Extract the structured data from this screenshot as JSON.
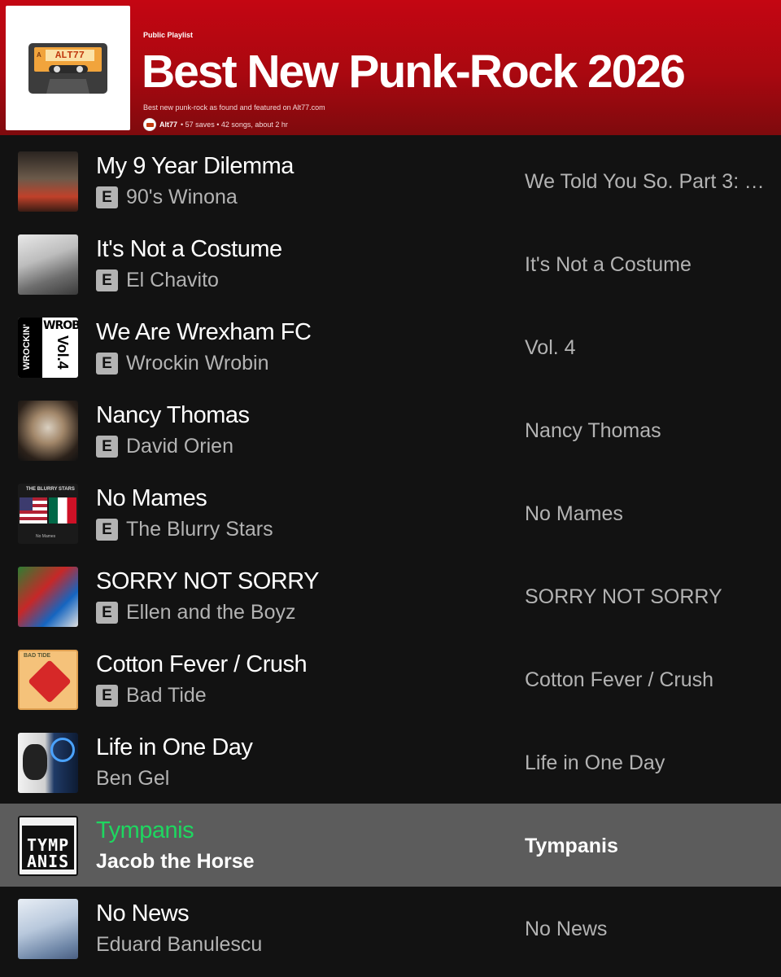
{
  "playlist": {
    "kind_label": "Public Playlist",
    "title": "Best New Punk-Rock 2026",
    "description": "Best new punk-rock as found and featured on Alt77.com",
    "owner": "Alt77",
    "stats": "• 57 saves • 42 songs, about 2 hr",
    "cover_text": "ALT77",
    "cover_side": "A"
  },
  "tracks": [
    {
      "title": "My 9 Year Dilemma",
      "artist": "90's Winona",
      "album": "We Told You So. Part 3: T...",
      "explicit": true,
      "active": false
    },
    {
      "title": "It's Not a Costume",
      "artist": "El Chavito",
      "album": "It's Not a Costume",
      "explicit": true,
      "active": false
    },
    {
      "title": "We Are Wrexham FC",
      "artist": "Wrockin Wrobin",
      "album": "Vol. 4",
      "explicit": true,
      "active": false
    },
    {
      "title": "Nancy Thomas",
      "artist": "David Orien",
      "album": "Nancy Thomas",
      "explicit": true,
      "active": false
    },
    {
      "title": "No Mames",
      "artist": "The Blurry Stars",
      "album": "No Mames",
      "explicit": true,
      "active": false
    },
    {
      "title": "SORRY NOT SORRY",
      "artist": "Ellen and the Boyz",
      "album": "SORRY NOT SORRY",
      "explicit": true,
      "active": false
    },
    {
      "title": "Cotton Fever / Crush",
      "artist": "Bad Tide",
      "album": "Cotton Fever / Crush",
      "explicit": true,
      "active": false
    },
    {
      "title": "Life in One Day",
      "artist": "Ben Gel",
      "album": "Life in One Day",
      "explicit": false,
      "active": false
    },
    {
      "title": "Tympanis",
      "artist": "Jacob the Horse",
      "album": "Tympanis",
      "explicit": false,
      "active": true
    },
    {
      "title": "No News",
      "artist": "Eduard Banulescu",
      "album": "No News",
      "explicit": false,
      "active": false
    }
  ],
  "explicit_badge": "E",
  "artwork_text": {
    "art3_top": "WROBIN",
    "art3_side": "Vol.4",
    "art3_left": "WROCKIN'",
    "art5_top": "THE BLURRY STARS",
    "art5_bottom": "No Mames",
    "art7_top": "BAD TIDE",
    "art9": "TYMP ANIS"
  },
  "colors": {
    "header_red": "#c40612",
    "active_green": "#1ed760",
    "background": "#121212",
    "active_row": "#5c5c5c"
  }
}
